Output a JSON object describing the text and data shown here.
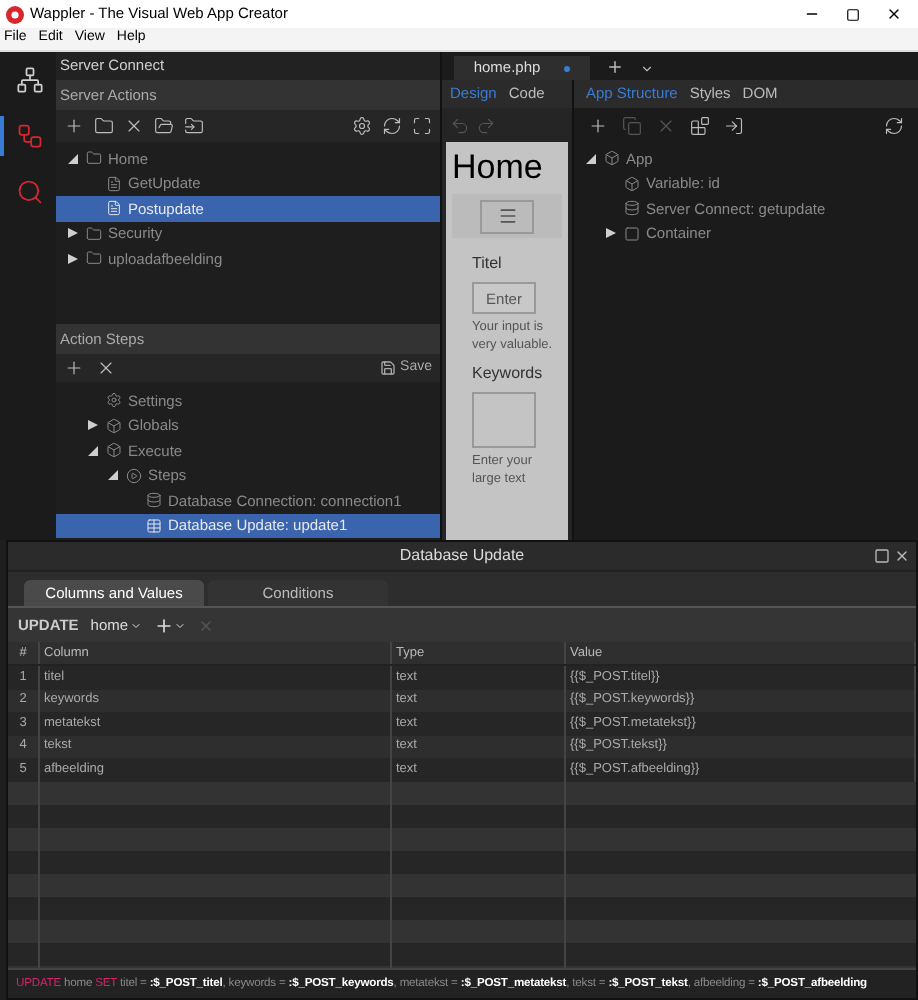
{
  "window": {
    "title": "Wappler - The Visual Web App Creator"
  },
  "menu": [
    "File",
    "Edit",
    "View",
    "Help"
  ],
  "rail": [
    {
      "selected": false
    },
    {
      "selected": true
    },
    {
      "selected": false
    }
  ],
  "server_connect": {
    "title": "Server Connect",
    "actions_title": "Server Actions",
    "actions_tree": [
      {
        "label": "Home",
        "kind": "folder",
        "expanded": true,
        "selected": false,
        "children": [
          {
            "label": "GetUpdate",
            "kind": "file",
            "selected": false
          },
          {
            "label": "Postupdate",
            "kind": "file",
            "selected": true
          }
        ]
      },
      {
        "label": "Security",
        "kind": "folder",
        "expanded": false,
        "selected": false
      },
      {
        "label": "uploadafbeelding",
        "kind": "folder",
        "expanded": false,
        "selected": false
      }
    ],
    "steps_title": "Action Steps",
    "save_label": "Save",
    "steps_tree": [
      {
        "label": "Settings",
        "kind": "settings",
        "selected": false
      },
      {
        "label": "Globals",
        "kind": "object",
        "expanded": false,
        "selected": false
      },
      {
        "label": "Execute",
        "kind": "object",
        "expanded": true,
        "selected": false,
        "children": [
          {
            "label": "Steps",
            "kind": "steps",
            "expanded": true,
            "selected": false,
            "children": [
              {
                "label": "Database Connection: connection1",
                "kind": "connection",
                "selected": false
              },
              {
                "label": "Database Update: update1",
                "kind": "update",
                "selected": true
              }
            ]
          }
        ]
      }
    ]
  },
  "editor_tab": {
    "label": "home.php",
    "unsaved": true
  },
  "view_tabs": [
    {
      "label": "Design",
      "selected": true
    },
    {
      "label": "Code",
      "selected": false
    }
  ],
  "preview": {
    "heading": "Home",
    "fields": [
      {
        "kind": "input",
        "label": "Titel",
        "placeholder": "Enter",
        "help": "Your input is very valuable."
      },
      {
        "kind": "textarea",
        "label": "Keywords",
        "help": "Enter your large text"
      }
    ]
  },
  "structure_tabs": [
    {
      "label": "App Structure",
      "selected": true
    },
    {
      "label": "Styles",
      "selected": false
    },
    {
      "label": "DOM",
      "selected": false
    }
  ],
  "structure_tree": [
    {
      "label": "App",
      "kind": "object",
      "expanded": true,
      "selected": false,
      "children": [
        {
          "label": "Variable: id",
          "kind": "object",
          "selected": false
        },
        {
          "label": "Server Connect: getupdate",
          "kind": "connection",
          "selected": false
        },
        {
          "label": "Container",
          "kind": "element",
          "expanded": false,
          "selected": false
        }
      ]
    }
  ],
  "dialog": {
    "title": "Database Update",
    "tabs": [
      {
        "label": "Columns and Values",
        "selected": true
      },
      {
        "label": "Conditions",
        "selected": false
      }
    ],
    "action": "UPDATE",
    "table_name": "home",
    "columns": [
      "#",
      "Column",
      "Type",
      "Value"
    ],
    "rows": [
      [
        "1",
        "titel",
        "text",
        "{{$_POST.titel}}"
      ],
      [
        "2",
        "keywords",
        "text",
        "{{$_POST.keywords}}"
      ],
      [
        "3",
        "metatekst",
        "text",
        "{{$_POST.metatekst}}"
      ],
      [
        "4",
        "tekst",
        "text",
        "{{$_POST.tekst}}"
      ],
      [
        "5",
        "afbeelding",
        "text",
        "{{$_POST.afbeelding}}"
      ]
    ],
    "sql": [
      {
        "kind": "keyword",
        "text": "UPDATE "
      },
      {
        "kind": "name",
        "text": "home "
      },
      {
        "kind": "keyword",
        "text": "SET "
      },
      {
        "kind": "name",
        "text": "titel = "
      },
      {
        "kind": "param",
        "text": ":$_POST_titel"
      },
      {
        "kind": "name",
        "text": ", keywords = "
      },
      {
        "kind": "param",
        "text": ":$_POST_keywords"
      },
      {
        "kind": "name",
        "text": ", metatekst = "
      },
      {
        "kind": "param",
        "text": ":$_POST_metatekst"
      },
      {
        "kind": "name",
        "text": ", tekst = "
      },
      {
        "kind": "param",
        "text": ":$_POST_tekst"
      },
      {
        "kind": "name",
        "text": ", afbeelding = "
      },
      {
        "kind": "param",
        "text": ":$_POST_afbeelding"
      }
    ]
  }
}
